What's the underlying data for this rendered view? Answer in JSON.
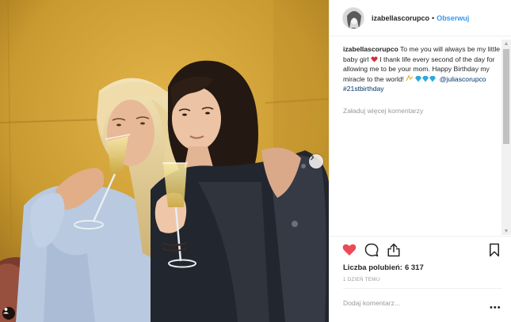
{
  "post": {
    "author": "izabellascorupco",
    "follow_label": "Obserwuj",
    "separator": "•",
    "caption_parts": {
      "user": "izabellascorupco",
      "text": "To me you will always be my little baby girl",
      "text2": "I thank life every second of the day for allowing me to be your mom. Happy Birthday my miracle to the world!",
      "mention": "@juliascorupco",
      "hashtag": "#21stbirthday"
    },
    "load_more_label": "Załaduj więcej komentarzy",
    "likes_label": "Liczba polubień:",
    "likes_count": "6 317",
    "date_label": "1 DZIEŃ TEMU",
    "comment_placeholder": "Dodaj komentarz...",
    "more_glyph": "•••"
  },
  "icons": {
    "like": "heart-filled-icon",
    "comment": "comment-icon",
    "share": "share-icon",
    "save": "bookmark-icon",
    "next": "chevron-right-icon",
    "tag": "user-tag-icon",
    "scroll_up": "scroll-up-icon",
    "scroll_down": "scroll-down-icon"
  },
  "colors": {
    "heart": "#ed4956",
    "link": "#003569",
    "follow": "#3897f0",
    "muted": "#999999",
    "emoji_heart": "#d62e3a",
    "emoji_diamond": "#2fa8d8"
  }
}
